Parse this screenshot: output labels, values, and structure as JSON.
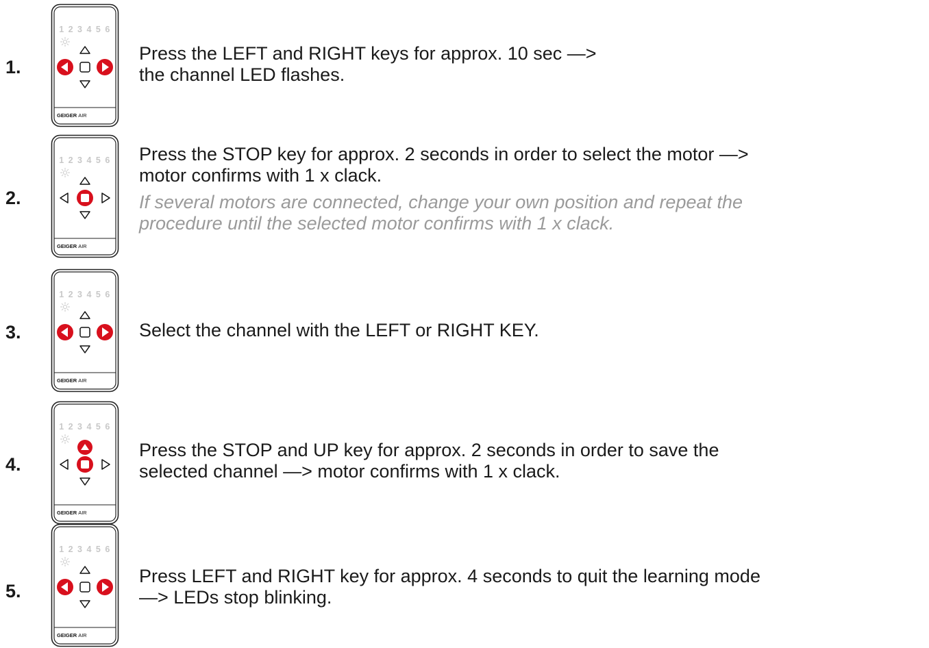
{
  "remote": {
    "channels": "1 2 3 4 5 6",
    "brand": "GEIGER",
    "model": "AIR"
  },
  "steps": [
    {
      "number": "1.",
      "lines": [
        "Press the LEFT and RIGHT keys for approx. 10 sec —>",
        "the channel LED flashes."
      ],
      "note": [],
      "pressed": [
        "left",
        "right"
      ]
    },
    {
      "number": "2.",
      "lines": [
        "Press the STOP key for approx. 2 seconds in order to select the motor —>",
        "motor confirms with 1 x clack."
      ],
      "note": [
        "If several motors are connected, change your own position and repeat the",
        "procedure until the selected motor confirms with 1 x clack."
      ],
      "pressed": [
        "stop"
      ]
    },
    {
      "number": "3.",
      "lines": [
        "Select the channel with the LEFT or RIGHT KEY."
      ],
      "note": [],
      "pressed": [
        "left",
        "right"
      ]
    },
    {
      "number": "4.",
      "lines": [
        "Press the STOP and UP key for approx. 2 seconds in order to save the",
        "selected channel —> motor confirms with 1 x clack."
      ],
      "note": [],
      "pressed": [
        "up",
        "stop"
      ]
    },
    {
      "number": "5.",
      "lines": [
        "Press LEFT and RIGHT key for approx. 4 seconds to quit the learning mode",
        "—> LEDs stop blinking."
      ],
      "note": [],
      "pressed": [
        "left",
        "right"
      ]
    }
  ]
}
